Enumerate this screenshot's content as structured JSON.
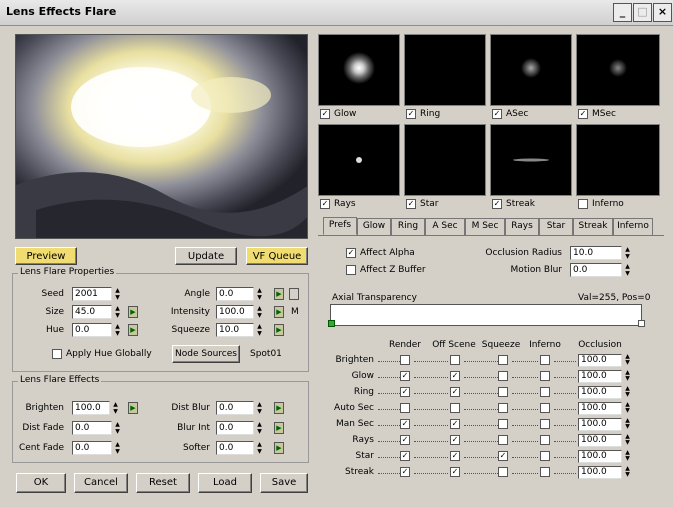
{
  "window": {
    "title": "Lens Effects Flare",
    "minimize": "_",
    "maximize": "□",
    "close": "×"
  },
  "left": {
    "preview_button": "Preview",
    "update_button": "Update",
    "vf_queue_button": "VF Queue",
    "props_group": "Lens Flare Properties",
    "seed": {
      "label": "Seed",
      "value": "2001"
    },
    "size": {
      "label": "Size",
      "value": "45.0"
    },
    "hue": {
      "label": "Hue",
      "value": "0.0"
    },
    "angle": {
      "label": "Angle",
      "value": "0.0"
    },
    "intensity": {
      "label": "Intensity",
      "value": "100.0"
    },
    "squeeze": {
      "label": "Squeeze",
      "value": "10.0"
    },
    "m_label": "M",
    "apply_hue": "Apply Hue Globally",
    "node_sources": "Node Sources",
    "node_value": "Spot01",
    "effects_group": "Lens Flare Effects",
    "brighten": {
      "label": "Brighten",
      "value": "100.0"
    },
    "dist_fade": {
      "label": "Dist Fade",
      "value": "0.0"
    },
    "cent_fade": {
      "label": "Cent Fade",
      "value": "0.0"
    },
    "dist_blur": {
      "label": "Dist Blur",
      "value": "0.0"
    },
    "blur_int": {
      "label": "Blur Int",
      "value": "0.0"
    },
    "softer": {
      "label": "Softer",
      "value": "0.0"
    }
  },
  "buttons": {
    "ok": "OK",
    "cancel": "Cancel",
    "reset": "Reset",
    "load": "Load",
    "save": "Save"
  },
  "thumbs": [
    {
      "label": "Glow",
      "checked": "✓"
    },
    {
      "label": "Ring",
      "checked": "✓"
    },
    {
      "label": "ASec",
      "checked": "✓"
    },
    {
      "label": "MSec",
      "checked": "✓"
    },
    {
      "label": "Rays",
      "checked": "✓"
    },
    {
      "label": "Star",
      "checked": "✓"
    },
    {
      "label": "Streak",
      "checked": "✓"
    },
    {
      "label": "Inferno",
      "checked": ""
    }
  ],
  "tabs": [
    "Prefs",
    "Glow",
    "Ring",
    "A Sec",
    "M Sec",
    "Rays",
    "Star",
    "Streak",
    "Inferno"
  ],
  "prefs": {
    "affect_alpha": "Affect Alpha",
    "affect_z": "Affect Z Buffer",
    "occlusion_radius": {
      "label": "Occlusion Radius",
      "value": "10.0"
    },
    "motion_blur": {
      "label": "Motion Blur",
      "value": "0.0"
    },
    "axial_label": "Axial Transparency",
    "axial_value": "Val=255, Pos=0",
    "cols": [
      "Render",
      "Off Scene",
      "Squeeze",
      "Inferno",
      "Occlusion"
    ],
    "rows": [
      {
        "label": "Brighten",
        "occ": "100.0"
      },
      {
        "label": "Glow",
        "occ": "100.0"
      },
      {
        "label": "Ring",
        "occ": "100.0"
      },
      {
        "label": "Auto Sec",
        "occ": "100.0"
      },
      {
        "label": "Man Sec",
        "occ": "100.0"
      },
      {
        "label": "Rays",
        "occ": "100.0"
      },
      {
        "label": "Star",
        "occ": "100.0"
      },
      {
        "label": "Streak",
        "occ": "100.0"
      }
    ]
  },
  "colors": {
    "accent": "#f0dc70",
    "lock": "#c8c8a0"
  }
}
